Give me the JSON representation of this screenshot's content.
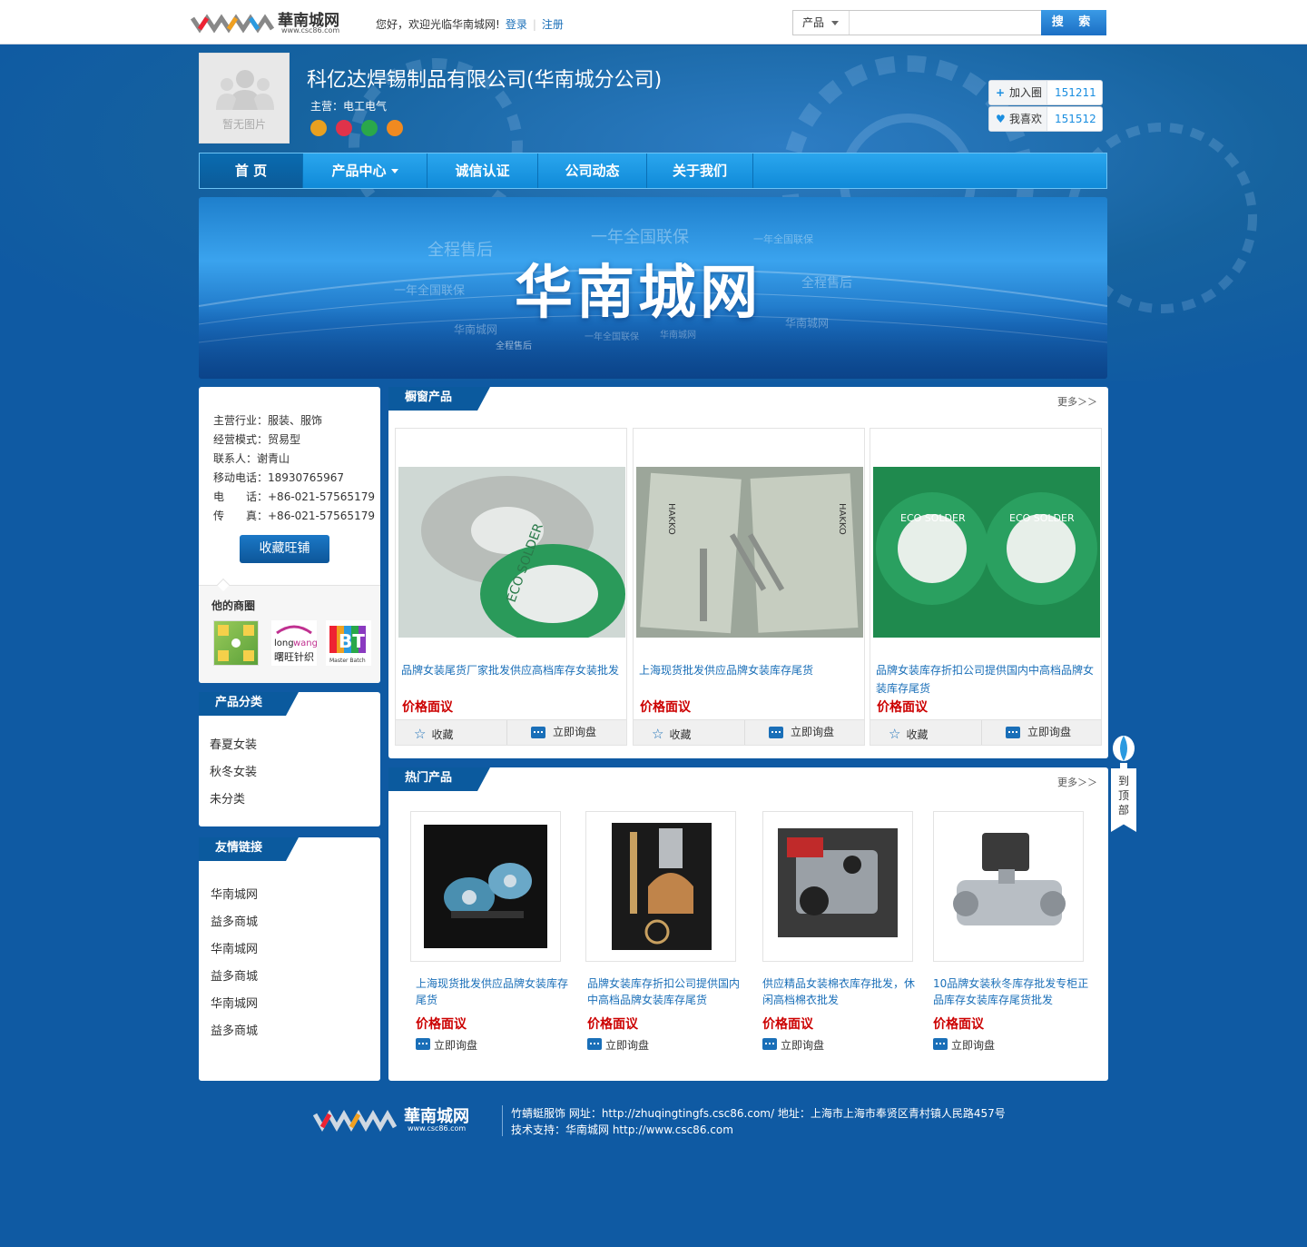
{
  "topbar": {
    "logo_text": "華南城网",
    "logo_url_text": "www.csc86.com",
    "welcome": "您好，欢迎光临华南城网!",
    "login": "登录",
    "register": "注册",
    "search_category": "产品",
    "search_placeholder": "",
    "search_button": "搜 索"
  },
  "shop": {
    "avatar_text": "暂无图片",
    "company_name": "科亿达焊锡制品有限公司(华南城分公司)",
    "main_business": "主营：电工电气",
    "join_circle_label": "加入圈",
    "join_circle_count": "151211",
    "like_label": "我喜欢",
    "like_count": "151512"
  },
  "nav": {
    "items": [
      "首  页",
      "产品中心",
      "诚信认证",
      "公司动态",
      "关于我们"
    ]
  },
  "banner": {
    "title": "华南城网",
    "watermarks": [
      "一年全国联保",
      "全程售后",
      "一年全国联保",
      "一年全国联保",
      "全程售后",
      "华南城网",
      "华南城网",
      "全程售后",
      "一年全国联保",
      "华南城网"
    ]
  },
  "info": {
    "industry": "主营行业：服装、服饰",
    "mode": "经营模式：贸易型",
    "contact": "联系人：谢青山",
    "mobile": "移动电话：18930765967",
    "phone": "电　　话：+86-021-57565179",
    "fax": "传　　真：+86-021-57565179",
    "favorite_button": "收藏旺铺",
    "other_shops_title": "他的商圈"
  },
  "categories": {
    "title": "产品分类",
    "items": [
      "春夏女装",
      "秋冬女装",
      "未分类"
    ]
  },
  "links": {
    "title": "友情链接",
    "items": [
      "华南城网",
      "益多商城",
      "华南城网",
      "益多商城",
      "华南城网",
      "益多商城"
    ]
  },
  "window_products": {
    "title": "橱窗产品",
    "more": "更多＞＞",
    "items": [
      {
        "title": "品牌女装尾货厂家批发供应高档库存女装批发",
        "price": "价格面议",
        "fav": "收藏",
        "ask": "立即询盘"
      },
      {
        "title": "上海现货批发供应品牌女装库存尾货",
        "price": "价格面议",
        "fav": "收藏",
        "ask": "立即询盘"
      },
      {
        "title": "品牌女装库存折扣公司提供国内中高档品牌女装库存尾货",
        "price": "价格面议",
        "fav": "收藏",
        "ask": "立即询盘"
      }
    ]
  },
  "hot_products": {
    "title": "热门产品",
    "more": "更多＞＞",
    "items": [
      {
        "title": "上海现货批发供应品牌女装库存尾货",
        "price": "价格面议",
        "ask": "立即询盘"
      },
      {
        "title": "品牌女装库存折扣公司提供国内中高档品牌女装库存尾货",
        "price": "价格面议",
        "ask": "立即询盘"
      },
      {
        "title": "供应精品女装棉衣库存批发，休闲高档棉衣批发",
        "price": "价格面议",
        "ask": "立即询盘"
      },
      {
        "title": "10品牌女装秋冬库存批发专柜正品库存女装库存尾货批发",
        "price": "价格面议",
        "ask": "立即询盘"
      }
    ]
  },
  "totop": "到顶部",
  "footer": {
    "line1": "竹蜻蜓服饰  网址：http://zhuqingtingfs.csc86.com/  地址：上海市上海市奉贤区青村镇人民路457号",
    "line2": "技术支持：华南城网 http://www.csc86.com"
  },
  "colors": {
    "page_bg": "#0f5aa3",
    "nav": "#1a9be6",
    "price": "#cc0000",
    "link": "#1a6fb8"
  }
}
